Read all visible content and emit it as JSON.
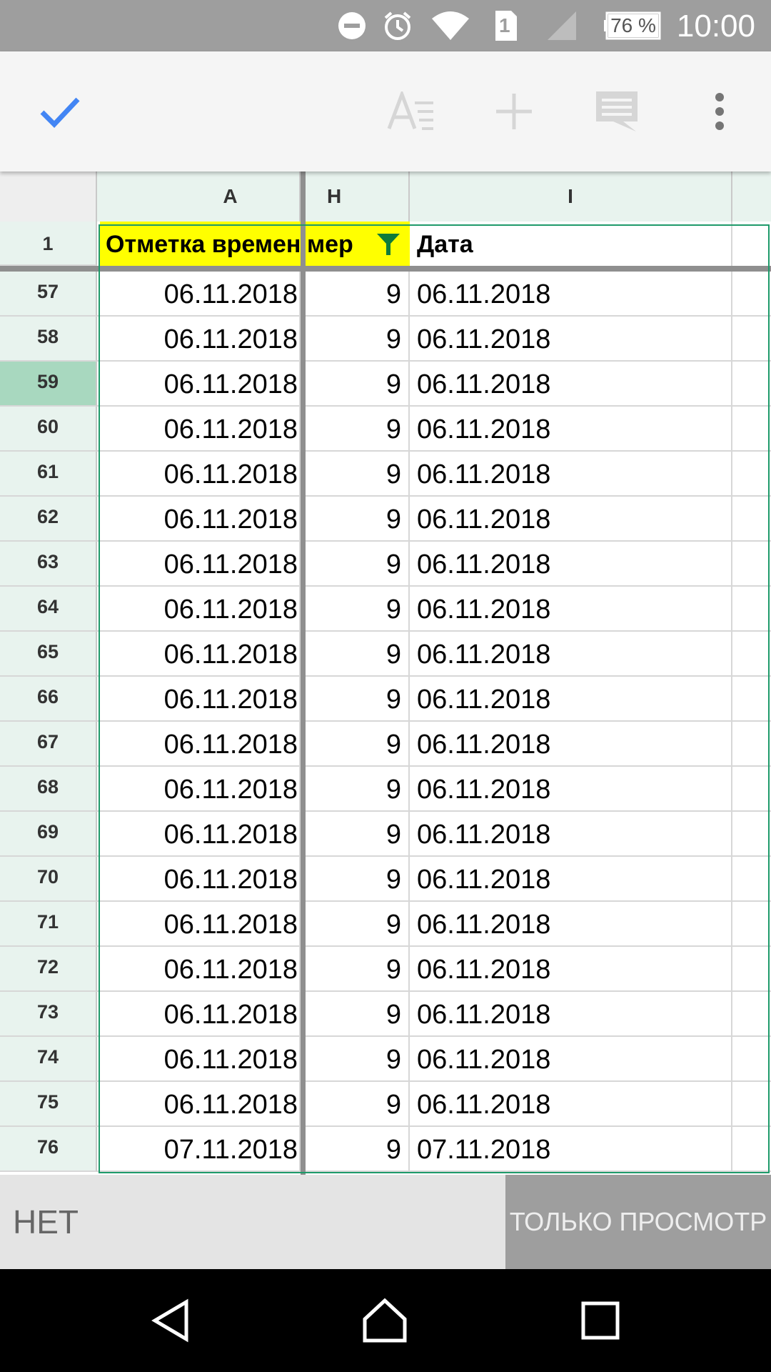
{
  "status_bar": {
    "battery": "76 %",
    "sim": "1",
    "time": "10:00"
  },
  "toolbar": {
    "done_icon": "check-icon",
    "format_icon": "text-format-icon",
    "insert_icon": "plus-icon",
    "comment_icon": "comment-icon",
    "more_icon": "more-vert-icon"
  },
  "columns": [
    "A",
    "H",
    "I"
  ],
  "header_row": {
    "number": "1",
    "a": "Отметка времени",
    "h": "мер",
    "i": "Дата"
  },
  "selected_row": "59",
  "rows": [
    {
      "num": "57",
      "a": "06.11.2018",
      "h": "9",
      "i": "06.11.2018"
    },
    {
      "num": "58",
      "a": "06.11.2018",
      "h": "9",
      "i": "06.11.2018"
    },
    {
      "num": "59",
      "a": "06.11.2018",
      "h": "9",
      "i": "06.11.2018"
    },
    {
      "num": "60",
      "a": "06.11.2018",
      "h": "9",
      "i": "06.11.2018"
    },
    {
      "num": "61",
      "a": "06.11.2018",
      "h": "9",
      "i": "06.11.2018"
    },
    {
      "num": "62",
      "a": "06.11.2018",
      "h": "9",
      "i": "06.11.2018"
    },
    {
      "num": "63",
      "a": "06.11.2018",
      "h": "9",
      "i": "06.11.2018"
    },
    {
      "num": "64",
      "a": "06.11.2018",
      "h": "9",
      "i": "06.11.2018"
    },
    {
      "num": "65",
      "a": "06.11.2018",
      "h": "9",
      "i": "06.11.2018"
    },
    {
      "num": "66",
      "a": "06.11.2018",
      "h": "9",
      "i": "06.11.2018"
    },
    {
      "num": "67",
      "a": "06.11.2018",
      "h": "9",
      "i": "06.11.2018"
    },
    {
      "num": "68",
      "a": "06.11.2018",
      "h": "9",
      "i": "06.11.2018"
    },
    {
      "num": "69",
      "a": "06.11.2018",
      "h": "9",
      "i": "06.11.2018"
    },
    {
      "num": "70",
      "a": "06.11.2018",
      "h": "9",
      "i": "06.11.2018"
    },
    {
      "num": "71",
      "a": "06.11.2018",
      "h": "9",
      "i": "06.11.2018"
    },
    {
      "num": "72",
      "a": "06.11.2018",
      "h": "9",
      "i": "06.11.2018"
    },
    {
      "num": "73",
      "a": "06.11.2018",
      "h": "9",
      "i": "06.11.2018"
    },
    {
      "num": "74",
      "a": "06.11.2018",
      "h": "9",
      "i": "06.11.2018"
    },
    {
      "num": "75",
      "a": "06.11.2018",
      "h": "9",
      "i": "06.11.2018"
    },
    {
      "num": "76",
      "a": "07.11.2018",
      "h": "9",
      "i": "07.11.2018"
    }
  ],
  "bottom_bar": {
    "cell_value": "НЕТ",
    "mode": "ТОЛЬКО ПРОСМОТР"
  },
  "colors": {
    "accent": "#4285f4",
    "header_fill": "#ffff00",
    "filter_green": "#0f7b3a",
    "selection_border": "#1e9a6a"
  }
}
